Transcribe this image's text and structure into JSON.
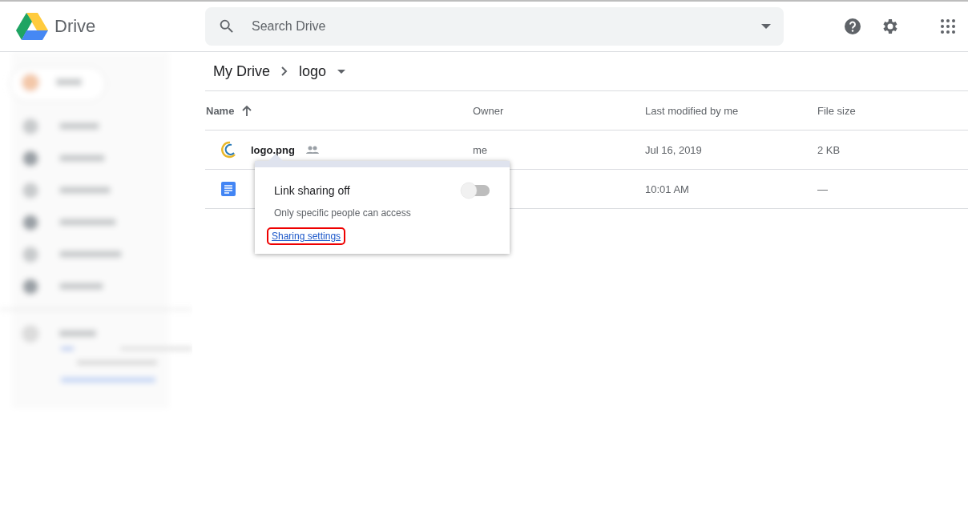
{
  "header": {
    "app_name": "Drive",
    "search": {
      "placeholder": "Search Drive"
    }
  },
  "breadcrumb": [
    "My Drive",
    "logo"
  ],
  "table": {
    "columns": [
      {
        "label": "Name",
        "sorted": true
      },
      {
        "label": "Owner",
        "sorted": false
      },
      {
        "label": "Last modified by me",
        "sorted": false
      },
      {
        "label": "File size",
        "sorted": false
      }
    ],
    "rows": [
      {
        "kind": "image",
        "name": "logo.png",
        "shared": true,
        "owner": "me",
        "modified": "Jul 16, 2019",
        "size": "2 KB"
      },
      {
        "kind": "doc",
        "shared": false,
        "modified": "10:01 AM",
        "size": "—"
      }
    ]
  },
  "popup": {
    "title": "Link sharing off",
    "on": false,
    "subtitle": "Only specific people can access",
    "link": "Sharing settings",
    "highlighted": true
  }
}
